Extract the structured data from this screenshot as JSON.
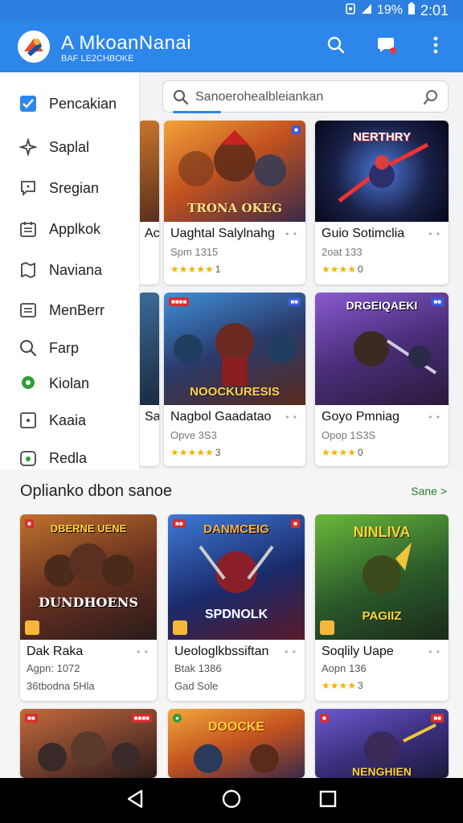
{
  "status": {
    "battery": "19%",
    "time": "2:01"
  },
  "app": {
    "title": "A MkoanNanai",
    "subtitle": "BAF LE2CHBOKE"
  },
  "drawer": {
    "items": [
      {
        "label": "Pencakian",
        "icon": "check-square-icon"
      },
      {
        "label": "Saplal",
        "icon": "sparkle-icon"
      },
      {
        "label": "Sregian",
        "icon": "chat-icon"
      },
      {
        "label": "Applkok",
        "icon": "calendar-icon"
      },
      {
        "label": "Naviana",
        "icon": "map-icon"
      },
      {
        "label": "MenBerr",
        "icon": "menu-icon"
      },
      {
        "label": "Farp",
        "icon": "search-icon"
      },
      {
        "label": "Kiolan",
        "icon": "location-icon"
      },
      {
        "label": "Kaaia",
        "icon": "square-dot-icon"
      },
      {
        "label": "Redla",
        "icon": "shield-icon"
      }
    ]
  },
  "search": {
    "placeholder": "Sanoerohealbleiankan"
  },
  "top_grid": {
    "partials": [
      {
        "title": "Ac",
        "sub": "Sa"
      }
    ],
    "cards": [
      {
        "title": "Uaghtal Salylnahg",
        "sub": "Spm 1315",
        "stars": "★★★★★",
        "rating": "1",
        "banner": "TRONA OKEG"
      },
      {
        "title": "Guio Sotimclia",
        "sub": "2oat 133",
        "stars": "★★★★",
        "rating": "0",
        "banner": "NERTHRY"
      },
      {
        "title": "Nagbol Gaadatao",
        "sub": "Opve 3S3",
        "stars": "★★★★★",
        "rating": "3",
        "banner": "NOOCKURESIS"
      },
      {
        "title": "Goyo Pmniag",
        "sub": "Opop 1S3S",
        "stars": "★★★★",
        "rating": "0",
        "banner": "DRGEIQAEKI"
      }
    ]
  },
  "section": {
    "title": "Oplianko dbon sanoe",
    "see_more": "Sane >",
    "cards": [
      {
        "title": "Dak Raka",
        "sub": "Agpn: 1072",
        "extra": "36tbodna 5Hla",
        "banner": "DBERNE UENE",
        "banner2": "DUNDHOENS"
      },
      {
        "title": "Ueologlkbssiftan",
        "sub": "Btak 1386",
        "extra": "Gad Sole",
        "banner": "DANMCEIG",
        "banner2": "SPDNOLK"
      },
      {
        "title": "Soqlily Uape",
        "sub": "Aopn 136",
        "stars": "★★★★",
        "rating": "3",
        "banner": "NINLIVA",
        "banner2": "PAGIIZ"
      },
      {
        "banner": ""
      },
      {
        "banner": "DOOCKE"
      },
      {
        "banner": "NENGHIEN"
      }
    ]
  },
  "colors": {
    "primary": "#2d86ea",
    "accent_green": "#2e7d32",
    "star": "#f4b400"
  }
}
